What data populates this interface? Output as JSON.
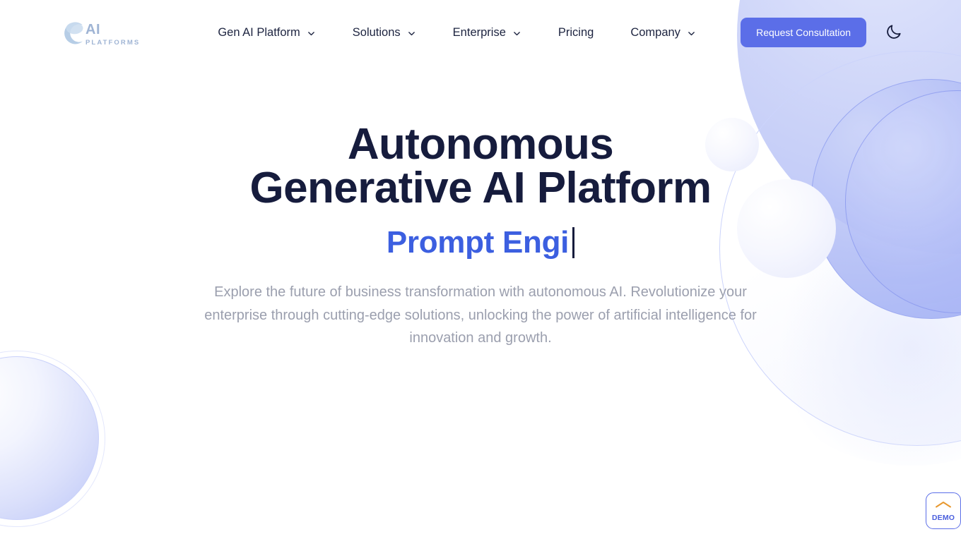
{
  "brand": {
    "logo_mark": "c-swoosh-logo-icon",
    "name": "AI",
    "tagline": "PLATFORMS"
  },
  "nav": {
    "items": [
      {
        "label": "Gen AI Platform",
        "has_dropdown": true
      },
      {
        "label": "Solutions",
        "has_dropdown": true
      },
      {
        "label": "Enterprise",
        "has_dropdown": true
      },
      {
        "label": "Pricing",
        "has_dropdown": false
      },
      {
        "label": "Company",
        "has_dropdown": true
      }
    ]
  },
  "header": {
    "cta_label": "Request Consultation",
    "theme_toggle_icon": "moon-icon"
  },
  "hero": {
    "title": "Autonomous Generative AI Platform",
    "typed_text": "Prompt Engi",
    "subtitle": "Explore the future of business transformation with autonomous AI. Revolutionize your enterprise through cutting-edge solutions, unlocking the power of artificial intelligence for innovation and growth."
  },
  "demo_widget": {
    "label": "DEMO",
    "icon": "chevron-up-icon"
  },
  "colors": {
    "accent_blue": "#5b6ee8",
    "typed_blue": "#3c5fe0",
    "heading_navy": "#161c3d",
    "subtitle_gray": "#9b9fae",
    "logo_blue": "#9fb4d4",
    "demo_orange": "#e8982e",
    "sphere_periwinkle": "#b3beF6",
    "page_background": "#ffffff"
  }
}
